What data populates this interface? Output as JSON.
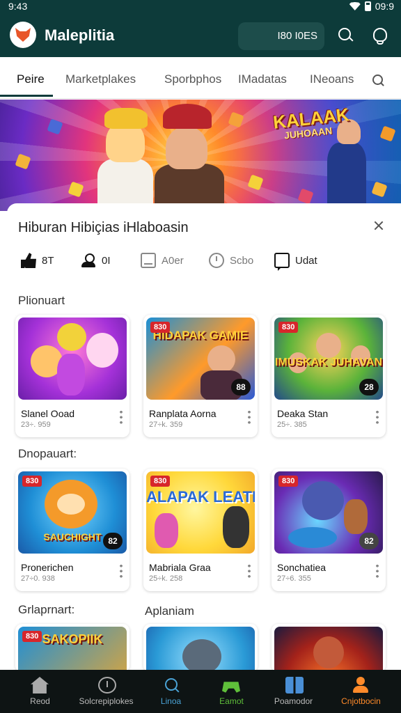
{
  "status": {
    "time": "9:43",
    "right_time": "09:9"
  },
  "header": {
    "title": "Maleplitia",
    "coins": "I80 I0ES",
    "accent": "#0d3b3a"
  },
  "tabs": [
    "Peire",
    "Marketplakes",
    "Sporbphos",
    "IMadatas",
    "INeoans"
  ],
  "banner": {
    "title": "KALAAK",
    "subtitle": "JUHOAAN"
  },
  "sheet": {
    "title": "Hiburan Hibiçias iHlaboasin",
    "actions": [
      {
        "label": "8T",
        "icon": "thumbs-up-icon"
      },
      {
        "label": "0I",
        "icon": "person-icon"
      },
      {
        "label": "A0er",
        "icon": "box-icon"
      },
      {
        "label": "Scbo",
        "icon": "clock-icon"
      },
      {
        "label": "Udat",
        "icon": "chat-icon"
      }
    ]
  },
  "sections": [
    {
      "title": "Plionuart",
      "cards": [
        {
          "name": "Slanel Ooad",
          "meta": "23÷. 959",
          "badge": "",
          "rating": "",
          "art": ""
        },
        {
          "name": "Ranplata Aorna",
          "meta": "27÷k. 359",
          "badge": "830",
          "rating": "88",
          "art": "HIDAPAK GAMIE"
        },
        {
          "name": "Deaka Stan",
          "meta": "25÷. 385",
          "badge": "830",
          "rating": "28",
          "art": "IMUSKAK JUHAVAN"
        }
      ]
    },
    {
      "title": "Dnopauart:",
      "cards": [
        {
          "name": "Pronerichen",
          "meta": "27÷0. 938",
          "badge": "830",
          "rating": "82",
          "art": "SAUCHIGHT"
        },
        {
          "name": "Mabriala Graa",
          "meta": "25÷k. 258",
          "badge": "830",
          "rating": "",
          "art": "ALAPAK LEATES"
        },
        {
          "name": "Sonchatiea",
          "meta": "27÷6. 355",
          "badge": "830",
          "rating": "82",
          "art": ""
        }
      ]
    },
    {
      "title": "Grlaprnart:",
      "title2": "Aplaniam",
      "cards": [
        {
          "badge": "830",
          "art": "SAKOPIIK"
        },
        {
          "badge": "",
          "art": ""
        },
        {
          "badge": "",
          "art": ""
        }
      ]
    }
  ],
  "bottom_nav": [
    {
      "label": "Reod",
      "icon": "home-icon"
    },
    {
      "label": "Solcrepiplokes",
      "icon": "clock-icon"
    },
    {
      "label": "Linoa",
      "icon": "search-icon"
    },
    {
      "label": "Eamot",
      "icon": "gamepad-icon"
    },
    {
      "label": "Poamodor",
      "icon": "grid-icon"
    },
    {
      "label": "Cnjotbocin",
      "icon": "user-icon"
    }
  ]
}
